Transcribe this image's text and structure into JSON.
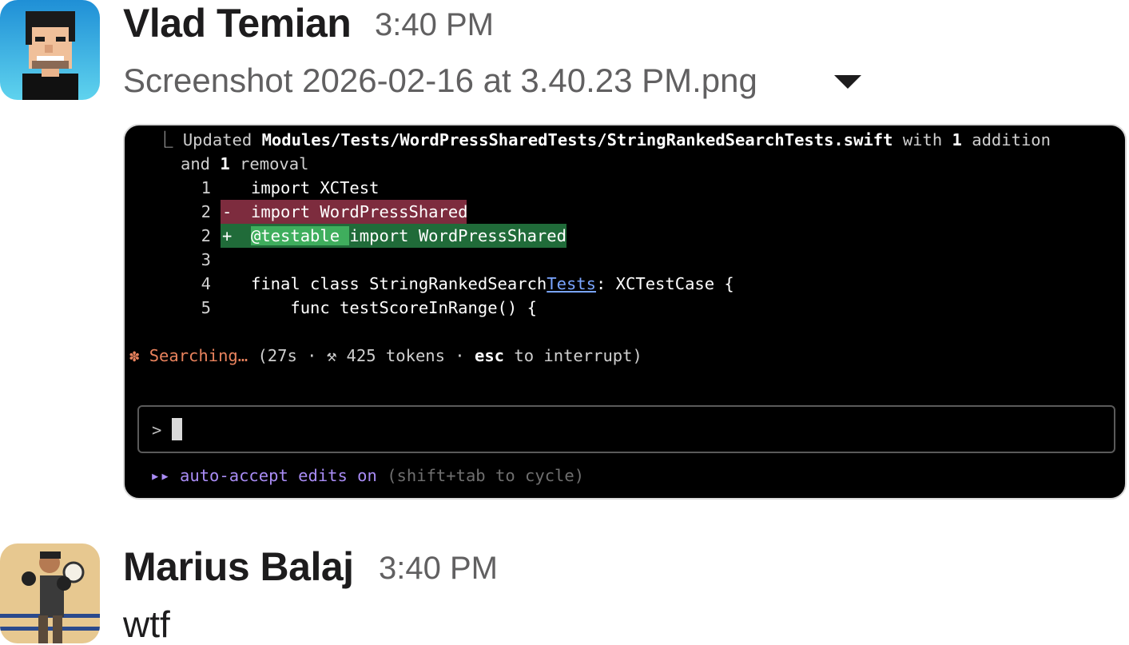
{
  "messages": [
    {
      "author": "Vlad Temian",
      "time": "3:40 PM",
      "attachment": {
        "filename": "Screenshot 2026-02-16 at 3.40.23 PM.png",
        "terminal": {
          "update_prefix": "⎿ Updated ",
          "update_path": "Modules/Tests/WordPressSharedTests/StringRankedSearchTests.swift",
          "update_with": " with ",
          "additions_count": "1",
          "additions_word": " addition",
          "and_word": "and ",
          "removals_count": "1",
          "removals_word": " removal",
          "diff": {
            "l1_num": "1",
            "l1_code": "import XCTest",
            "l2_num": "2",
            "l2_sign": "-",
            "l2_code": "import WordPressShared",
            "l3_num": "2",
            "l3_sign": "+",
            "l3_code_hl": "@testable ",
            "l3_code_rest": "import WordPressShared",
            "l4_num": "3",
            "l5_num": "4",
            "l5_code_pre": "final class StringRankedSearch",
            "l5_code_link": "Tests",
            "l5_code_post": ": XCTestCase {",
            "l6_num": "5",
            "l6_code": "    func testScoreInRange() {"
          },
          "status_glyph": "✽",
          "status_word": "Searching…",
          "status_open": " (27s · ",
          "status_icon": "⚒",
          "status_tokens": " 425 tokens · ",
          "status_key": "esc",
          "status_tail": " to interrupt)",
          "prompt_symbol": ">",
          "mode_arrows": "▸▸",
          "mode_label": " auto-accept edits on",
          "mode_hint": " (shift+tab to cycle)"
        }
      }
    },
    {
      "author": "Marius Balaj",
      "time": "3:40 PM",
      "text": "wtf"
    }
  ],
  "icons": {
    "attachment_toggle": "caret-down-icon",
    "status": "asterisk-icon",
    "tool": "hammer-pick-icon"
  },
  "colors": {
    "deleted_line": "#7d2c3e",
    "added_line": "#206b39",
    "added_highlight": "#3fae5d",
    "status": "#e8825d",
    "mode": "#a98cf5"
  }
}
